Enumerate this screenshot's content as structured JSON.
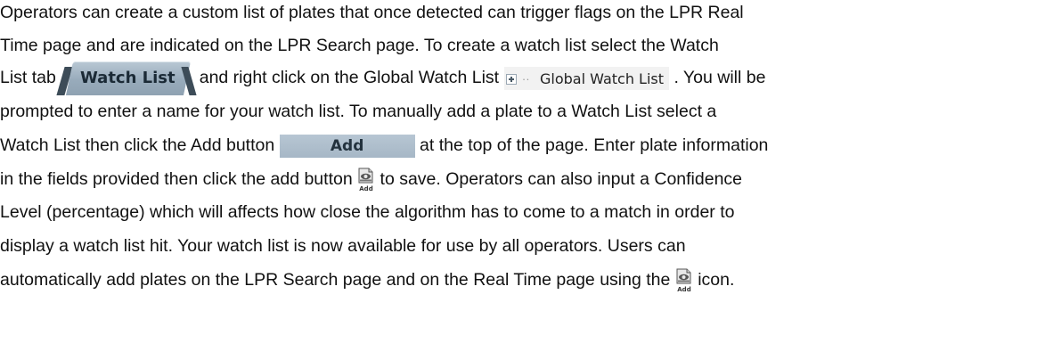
{
  "paragraph": {
    "line1": "Operators can create a custom list of plates that once detected can trigger flags on the LPR Real",
    "line2": "Time page and are indicated on the LPR Search page.  To create a watch list select the Watch",
    "line3_before": "List tab",
    "watch_list_tab_label": "Watch List",
    "line3_middle": "and right click on the Global Watch List",
    "global_watch_list_label": "Global Watch List",
    "line3_after": ".  You will be",
    "line4": "prompted to enter a name for your watch list.  To manually add a plate to a Watch List select a",
    "line5_before": "Watch List then click the Add button",
    "add_button_label": "Add",
    "line5_after": "at the top of the page.  Enter plate information",
    "line6_before": "in the fields provided then click the add button",
    "line6_after": "to save.  Operators can also input a Confidence",
    "line7": "Level (percentage) which will affects how close the algorithm has to come to a match in order to",
    "line8": "display a watch list hit.  Your watch list is now available for use by all operators.   Users can",
    "line9_before": "automatically add plates on the LPR Search page and on the Real Time page using the",
    "line9_after": "icon.",
    "add_icon_caption": "Add"
  },
  "icons": {
    "add_icon": "document-with-eye-icon",
    "expand_icon": "tree-expand-plus-icon"
  },
  "colors": {
    "tab_fill": "#a9bac8",
    "tab_edge": "#3d4c58",
    "button_fill": "#aebfcd",
    "tree_node_bg": "#f2f2f2"
  }
}
